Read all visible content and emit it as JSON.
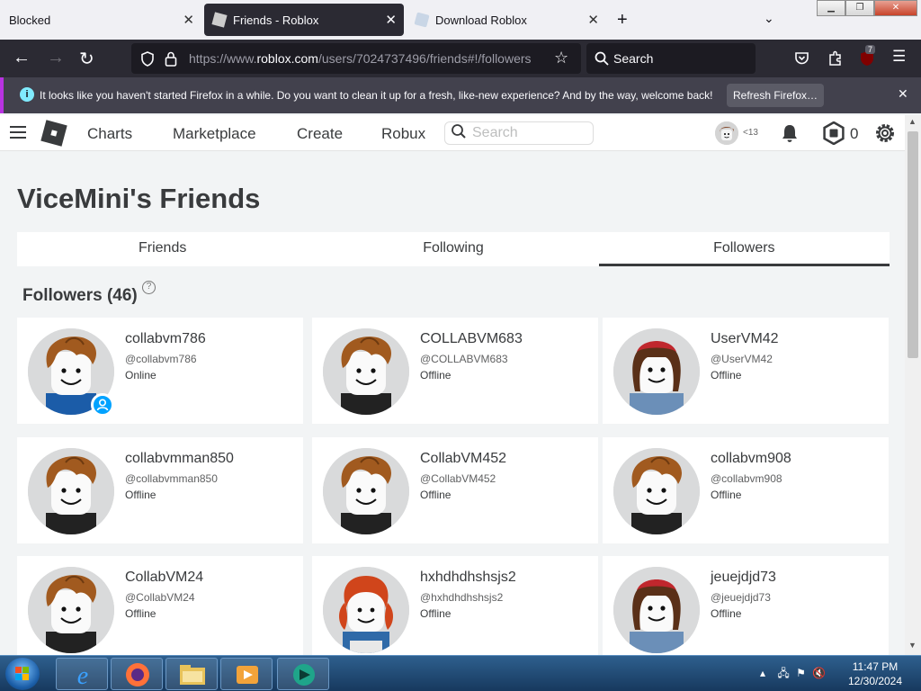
{
  "browser": {
    "tabs": [
      {
        "label": "Blocked",
        "active": false
      },
      {
        "label": "Friends - Roblox",
        "active": true
      },
      {
        "label": "Download Roblox",
        "active": false
      }
    ],
    "url_prefix": "https://www.",
    "url_domain": "roblox.com",
    "url_path": "/users/7024737496/friends#!/followers",
    "search_label": "Search",
    "extension_badge": "7",
    "notification": {
      "message": "It looks like you haven't started Firefox in a while. Do you want to clean it up for a fresh, like-new experience? And by the way, welcome back!",
      "button": "Refresh Firefox…"
    }
  },
  "header": {
    "nav": [
      "Charts",
      "Marketplace",
      "Create",
      "Robux"
    ],
    "search_placeholder": "Search",
    "age_tag": "<13",
    "robux": "0"
  },
  "page": {
    "title": "ViceMini's Friends",
    "tabs": [
      "Friends",
      "Following",
      "Followers"
    ],
    "active_tab": "Followers",
    "section_title": "Followers (46)",
    "help": "?"
  },
  "followers": [
    {
      "name": "collabvm786",
      "handle": "@collabvm786",
      "status": "Online",
      "avatar": "hair-bacon"
    },
    {
      "name": "COLLABVM683",
      "handle": "@COLLABVM683",
      "status": "Offline",
      "avatar": "hair-bacon"
    },
    {
      "name": "UserVM42",
      "handle": "@UserVM42",
      "status": "Offline",
      "avatar": "hair-brown-cap"
    },
    {
      "name": "collabvmman850",
      "handle": "@collabvmman850",
      "status": "Offline",
      "avatar": "hair-bacon"
    },
    {
      "name": "CollabVM452",
      "handle": "@CollabVM452",
      "status": "Offline",
      "avatar": "hair-bacon"
    },
    {
      "name": "collabvm908",
      "handle": "@collabvm908",
      "status": "Offline",
      "avatar": "hair-bacon"
    },
    {
      "name": "CollabVM24",
      "handle": "@CollabVM24",
      "status": "Offline",
      "avatar": "hair-bacon"
    },
    {
      "name": "hxhdhdhshsjs2",
      "handle": "@hxhdhdhshsjs2",
      "status": "Offline",
      "avatar": "hair-red-pigtails"
    },
    {
      "name": "jeuejdjd73",
      "handle": "@jeuejdjd73",
      "status": "Offline",
      "avatar": "hair-brown-cap"
    }
  ],
  "taskbar": {
    "time": "11:47 PM",
    "date": "12/30/2024"
  },
  "colors": {
    "roblox_text": "#393b3d",
    "presence_online": "#00a2ff",
    "firefox_toolbar": "#2b2a33"
  }
}
